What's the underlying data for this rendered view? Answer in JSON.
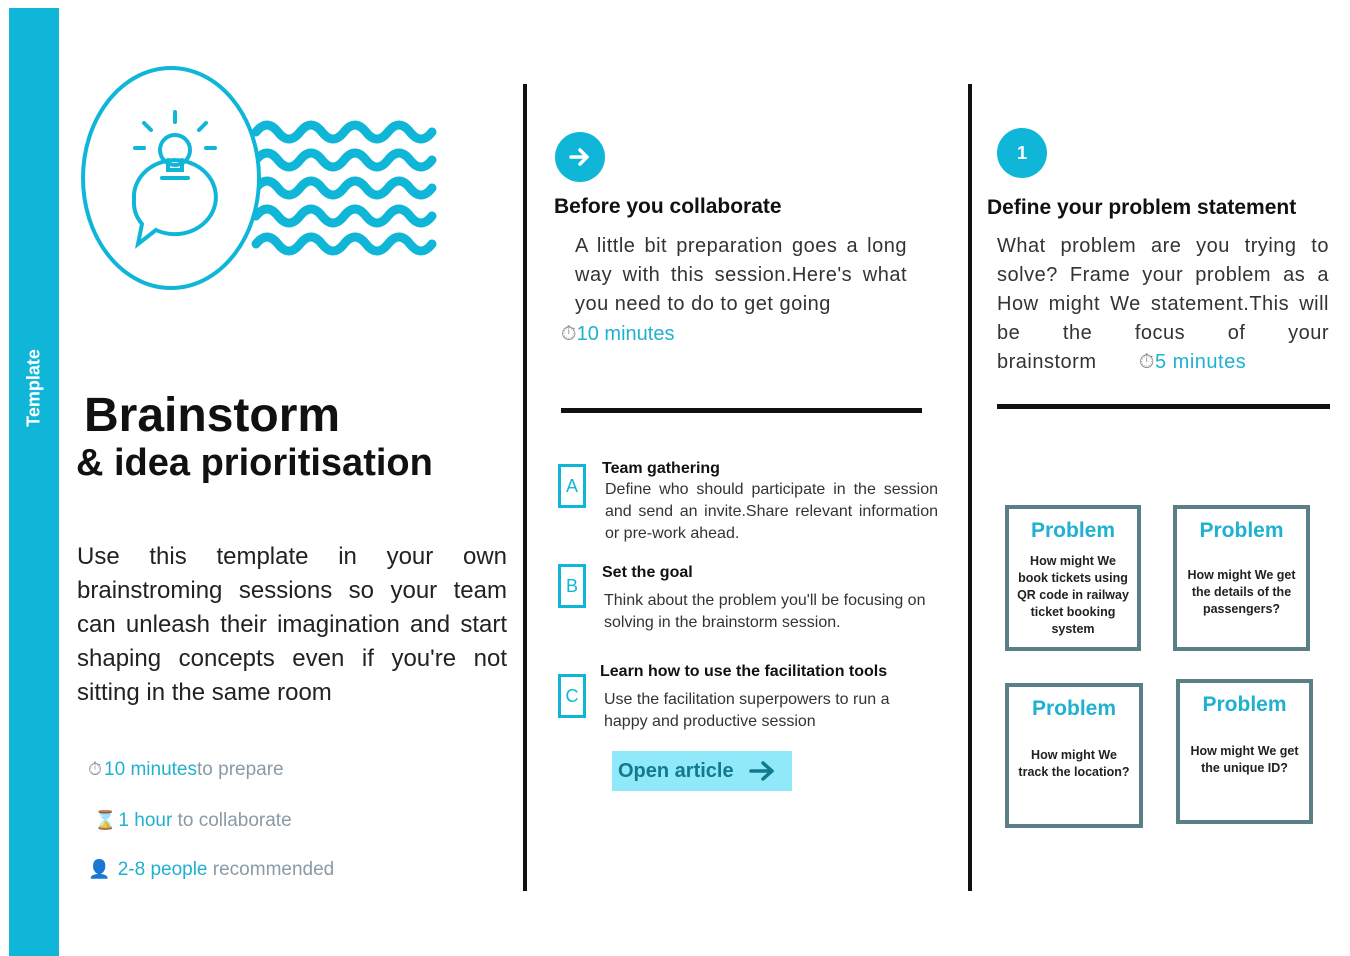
{
  "sidebar": {
    "label": "Template"
  },
  "hero": {
    "title_line1": "Brainstorm",
    "title_line2": "& idea prioritisation"
  },
  "intro": {
    "description": "Use this template in your own brainstroming sessions so your team can unleash their imagination and start shaping concepts even if you're not sitting in the same room",
    "prepare": {
      "icon": "stopwatch-icon",
      "value": "10 minutes",
      "suffix": "to prepare"
    },
    "collaborate": {
      "icon": "hourglass-icon",
      "value": "1 hour",
      "suffix": " to collaborate"
    },
    "people": {
      "icon": "person-icon",
      "value": "2-8 people",
      "suffix": " recommended"
    }
  },
  "before": {
    "icon": "arrow-right-icon",
    "heading": "Before you collaborate",
    "body": "A little bit preparation goes a long way with this session.Here's what you need to do to get going",
    "time": "10 minutes"
  },
  "steps": [
    {
      "letter": "A",
      "title": "Team gathering",
      "body": "Define who should participate in the session and send an invite.Share relevant information or pre-work ahead."
    },
    {
      "letter": "B",
      "title": "Set the goal",
      "body": "Think about the problem you'll be focusing on solving in the brainstorm session."
    },
    {
      "letter": "C",
      "title": "Learn how to use the facilitation tools",
      "body": "Use the facilitation superpowers to run a happy and productive session"
    }
  ],
  "open_article": {
    "label": "Open article"
  },
  "define": {
    "number": "1",
    "heading": "Define your problem statement",
    "body": "What problem are you trying to solve? Frame your problem as a How might We statement.This will be the focus of your brainstorm",
    "time": "5 minutes"
  },
  "problems": [
    {
      "title": "Problem",
      "text": "How might We book tickets using QR code in railway ticket booking system"
    },
    {
      "title": "Problem",
      "text": "How might We get the details of the passengers?"
    },
    {
      "title": "Problem",
      "text": "How might We track the location?"
    },
    {
      "title": "Problem",
      "text": "How might We get the unique ID?"
    }
  ],
  "colors": {
    "accent": "#0fb6d8",
    "card_border": "#5b7f87",
    "button_bg": "#8fe9f8"
  }
}
